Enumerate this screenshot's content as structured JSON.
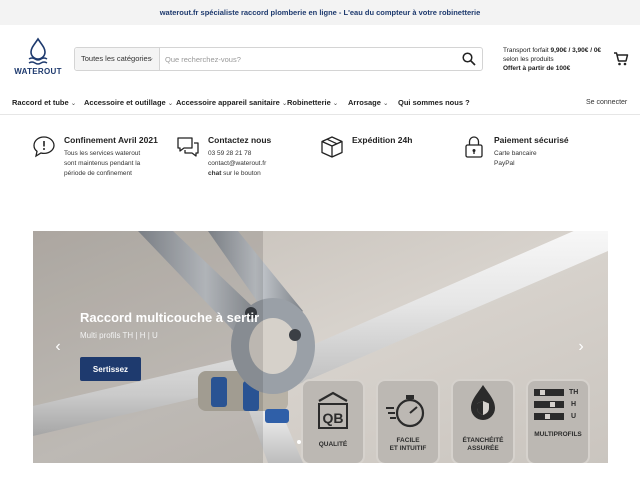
{
  "announcement": "waterout.fr spécialiste raccord plomberie en ligne - L'eau du compteur à votre robinetterie",
  "logo": {
    "text": "WATEROUT",
    "color": "#1e3a6e"
  },
  "search": {
    "category": "Toutes les catégories",
    "placeholder": "Que recherchez-vous?"
  },
  "shipping": {
    "line1_prefix": "Transport forfait ",
    "line1_bold": "9,90€ / 3,90€ / 0€",
    "line2": "selon les produits",
    "line3": "Offert à partir de 100€"
  },
  "nav": {
    "items": [
      {
        "label": "Raccord et tube",
        "chevron": "chevron-down-icon"
      },
      {
        "label": "Accessoire et outillage",
        "chevron": "chevron-down-icon"
      },
      {
        "label": "Accessoire appareil sanitaire",
        "chevron": "chevron-down-icon"
      },
      {
        "label": "Robinetterie",
        "chevron": "chevron-down-icon"
      },
      {
        "label": "Arrosage",
        "chevron": "chevron-down-icon"
      },
      {
        "label": "Qui sommes nous ?"
      }
    ],
    "login": "Se connecter"
  },
  "features": [
    {
      "icon": "speech-bubble-icon",
      "title": "Confinement Avril 2021",
      "lines": [
        "Tous les services waterout",
        "sont maintenus pendant la",
        "période de confinement"
      ]
    },
    {
      "icon": "chat-icon",
      "title": "Contactez nous",
      "lines": [
        "03 59 28 21 78",
        "contact@waterout.fr"
      ],
      "chat_bold": "chat",
      "chat_rest": " sur le bouton"
    },
    {
      "icon": "package-icon",
      "title": "Expédition 24h",
      "lines": []
    },
    {
      "icon": "padlock-icon",
      "title": "Paiement sécurisé",
      "lines": [
        "Carte bancaire",
        "PayPal"
      ]
    }
  ],
  "hero": {
    "title": "Raccord multicouche à sertir",
    "subtitle": "Multi profils TH | H | U",
    "button": "Sertissez",
    "slide_count": 5,
    "active_slide": 1,
    "badges": [
      {
        "label1": "QUALITÉ",
        "label2": ""
      },
      {
        "label1": "FACILE",
        "label2": "ET INTUITIF"
      },
      {
        "label1": "ÉTANCHÉITÉ",
        "label2": "ASSURÉE"
      },
      {
        "label1": "MULTIPROFILS",
        "label2": "",
        "profiles": [
          "TH",
          "H",
          "U"
        ]
      }
    ]
  }
}
